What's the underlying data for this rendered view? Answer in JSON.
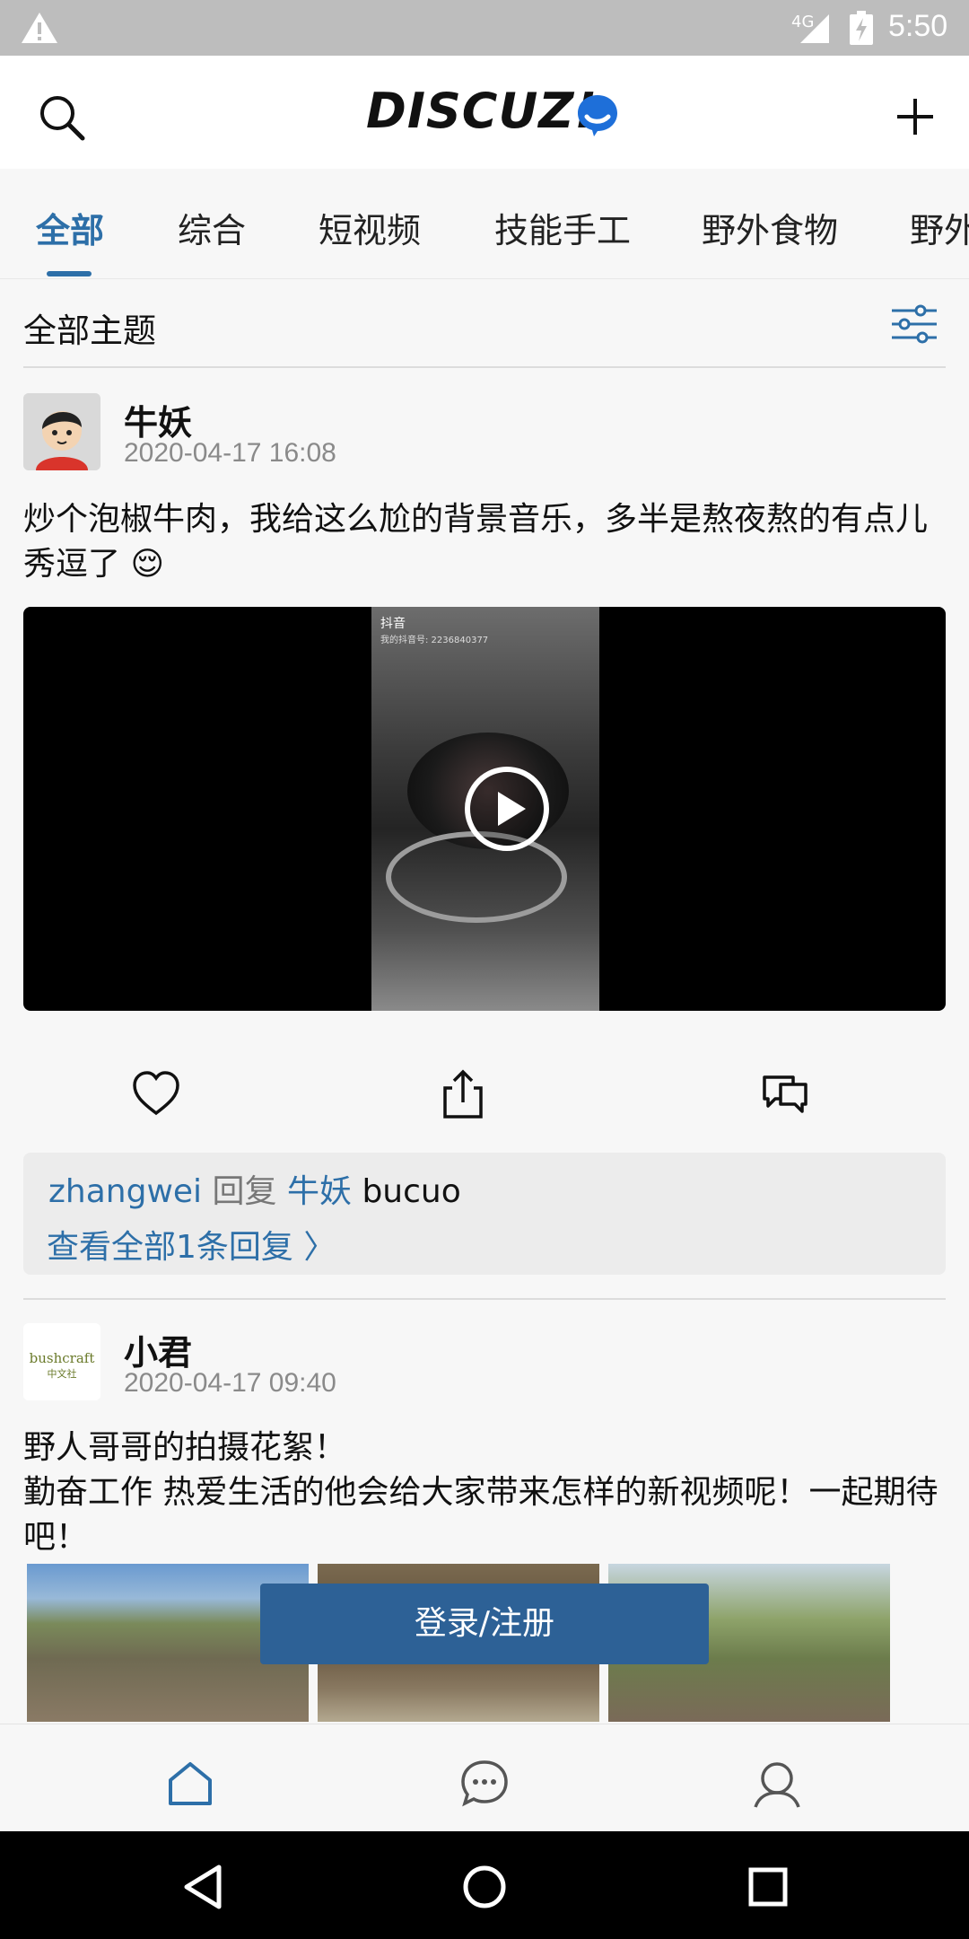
{
  "status_bar": {
    "network": "4G",
    "time": "5:50"
  },
  "header": {
    "logo_text": "DISCUZ!"
  },
  "tabs": [
    {
      "label": "全部",
      "active": true
    },
    {
      "label": "综合"
    },
    {
      "label": "短视频"
    },
    {
      "label": "技能手工"
    },
    {
      "label": "野外食物"
    },
    {
      "label": "野外"
    }
  ],
  "section": {
    "title": "全部主题"
  },
  "posts": [
    {
      "author": "牛妖",
      "date": "2020-04-17 16:08",
      "text": "炒个泡椒牛肉，我给这么尬的背景音乐，多半是熬夜熬的有点儿秀逗了 😌",
      "video": {
        "watermark": "抖音",
        "watermark_sub": "我的抖音号: 2236840377"
      },
      "reply": {
        "from": "zhangwei",
        "verb": "回复",
        "to": "牛妖",
        "text": "bucuo",
        "view_all": "查看全部1条回复 〉"
      }
    },
    {
      "author": "小君",
      "date": "2020-04-17 09:40",
      "avatar_text": "bushcraft 中文社",
      "text_line1": "野人哥哥的拍摄花絮！",
      "text_line2": "勤奋工作 热爱生活的他会给大家带来怎样的新视频呢！一起期待吧！"
    }
  ],
  "login_button": "登录/注册",
  "colors": {
    "accent": "#2d6fa8",
    "login_bg": "#2d6196"
  }
}
